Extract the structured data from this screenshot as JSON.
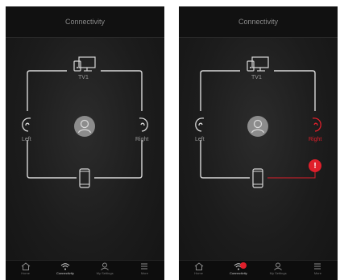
{
  "screens": [
    {
      "title": "Connectivity",
      "tv_label": "TV1",
      "left_label": "Left",
      "right_label": "Right",
      "right_state": "normal",
      "tabs": [
        {
          "label": "Home",
          "icon": "home-icon",
          "active": false
        },
        {
          "label": "Connectivity",
          "icon": "wifi-icon",
          "active": true
        },
        {
          "label": "My Settings",
          "icon": "person-icon",
          "active": false
        },
        {
          "label": "More",
          "icon": "menu-icon",
          "active": false
        }
      ]
    },
    {
      "title": "Connectivity",
      "tv_label": "TV1",
      "left_label": "Left",
      "right_label": "Right",
      "right_state": "error",
      "error_badge": "!",
      "tabs": [
        {
          "label": "Home",
          "icon": "home-icon",
          "active": false
        },
        {
          "label": "Connectivity",
          "icon": "wifi-icon",
          "active": true,
          "badge": true
        },
        {
          "label": "My Settings",
          "icon": "person-icon",
          "active": false
        },
        {
          "label": "More",
          "icon": "menu-icon",
          "active": false
        }
      ]
    }
  ],
  "colors": {
    "line": "#d9d9d9",
    "error": "#e01f2b",
    "avatar": "#8c8c8c"
  }
}
